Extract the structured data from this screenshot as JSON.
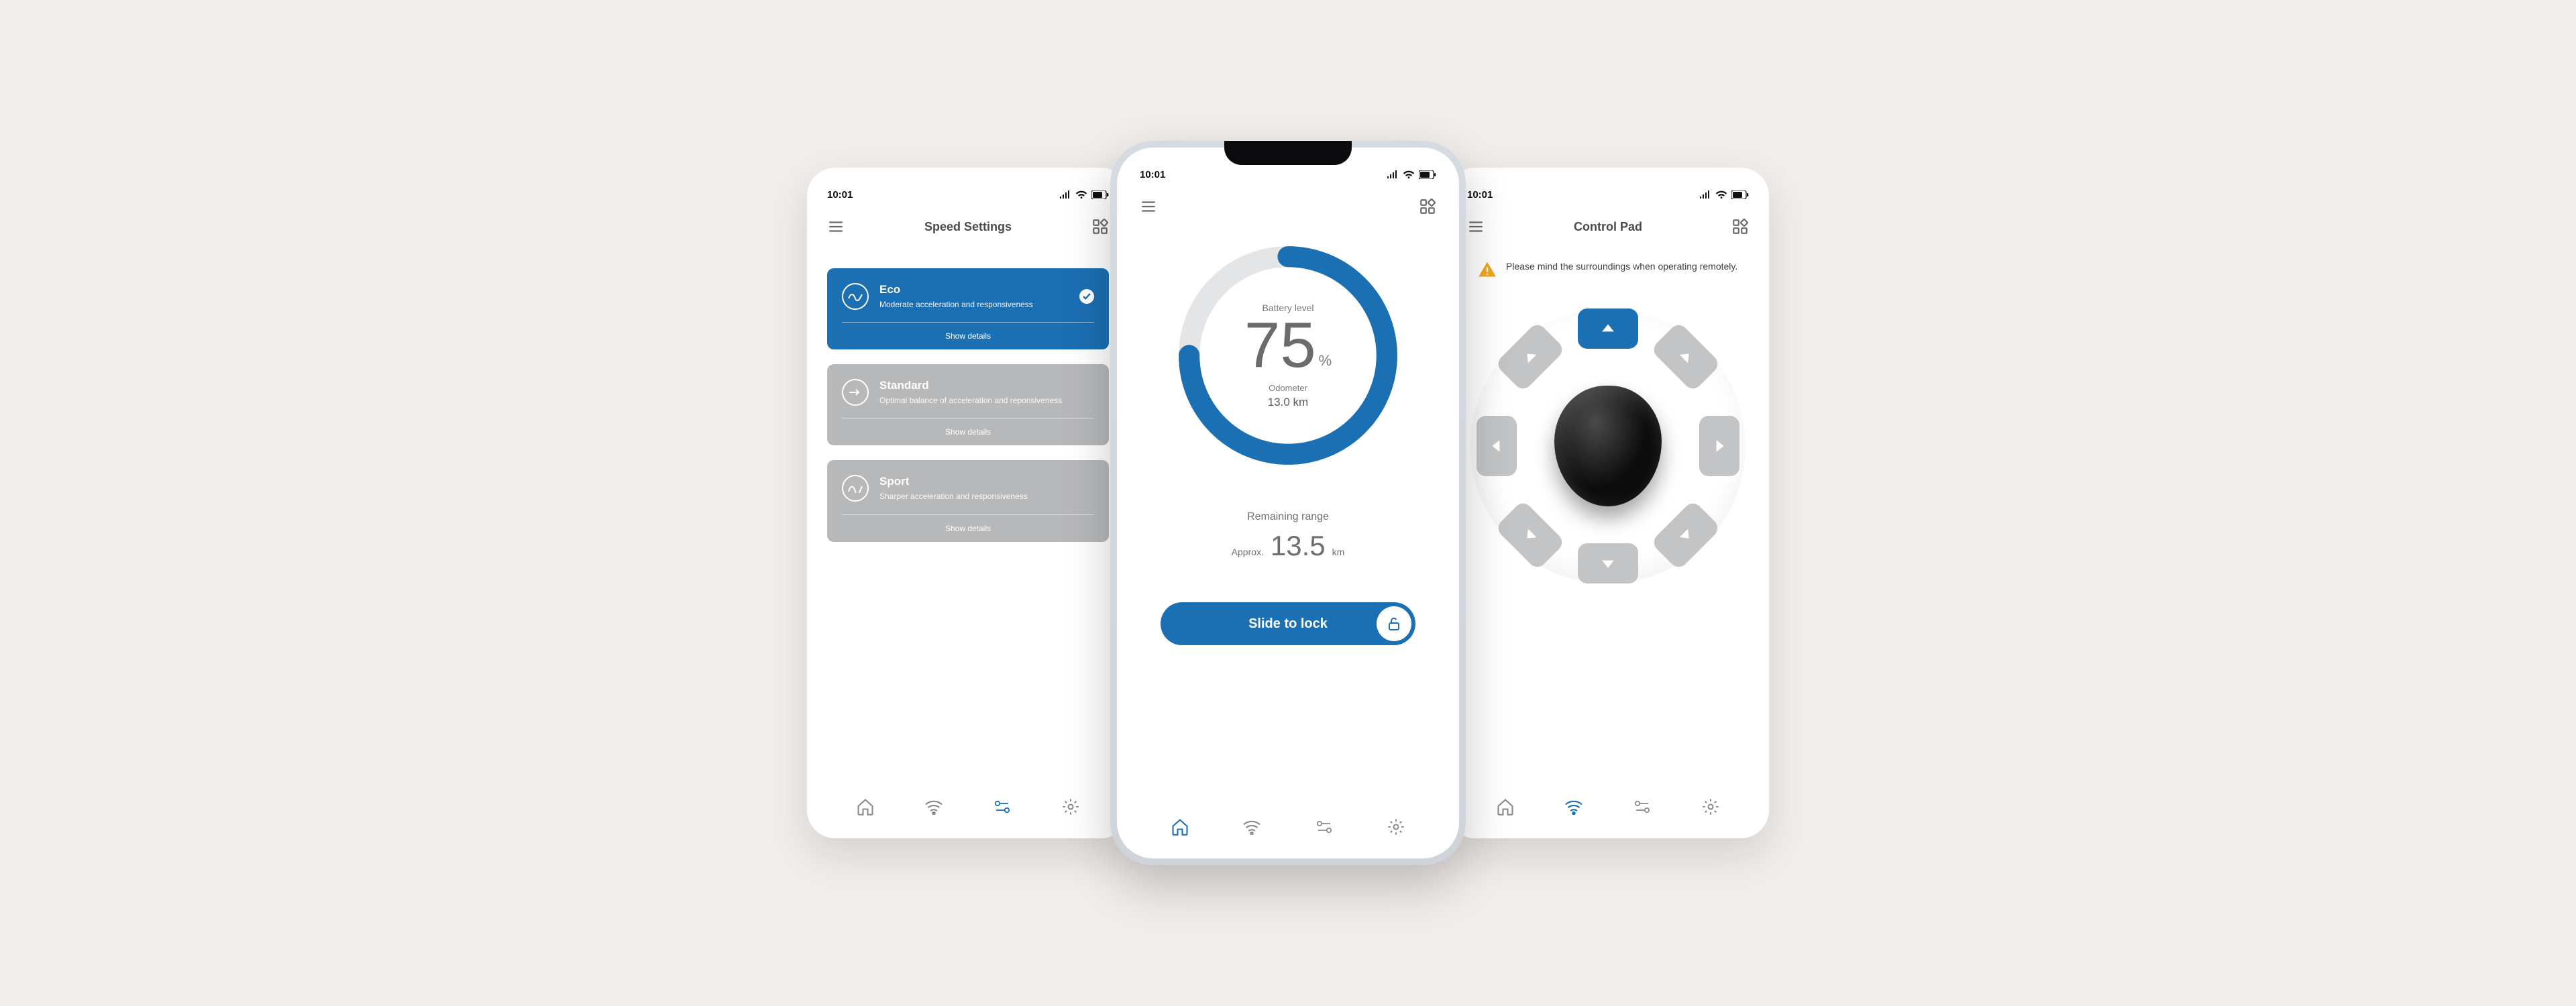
{
  "status_time": "10:01",
  "accent": "#1b6fb3",
  "screens": {
    "speed": {
      "title": "Speed Settings",
      "modes": [
        {
          "name": "Eco",
          "desc": "Moderate acceleration and responsiveness",
          "details": "Show details",
          "selected": true
        },
        {
          "name": "Standard",
          "desc": "Optimal balance of acceleration and reponsiveness",
          "details": "Show details",
          "selected": false
        },
        {
          "name": "Sport",
          "desc": "Sharper acceleration and responsiveness",
          "details": "Show details",
          "selected": false
        }
      ],
      "active_tab": "speed"
    },
    "home": {
      "battery_label": "Battery level",
      "battery_value": "75",
      "battery_unit": "%",
      "odometer_label": "Odometer",
      "odometer_value": "13.0 km",
      "range_label": "Remaining range",
      "range_prefix": "Approx.",
      "range_value": "13.5",
      "range_unit": "km",
      "slide_label": "Slide to lock",
      "active_tab": "home"
    },
    "control": {
      "title": "Control Pad",
      "warning": "Please mind the surroundings when operating remotely.",
      "active_direction": "up",
      "active_tab": "wifi"
    }
  }
}
